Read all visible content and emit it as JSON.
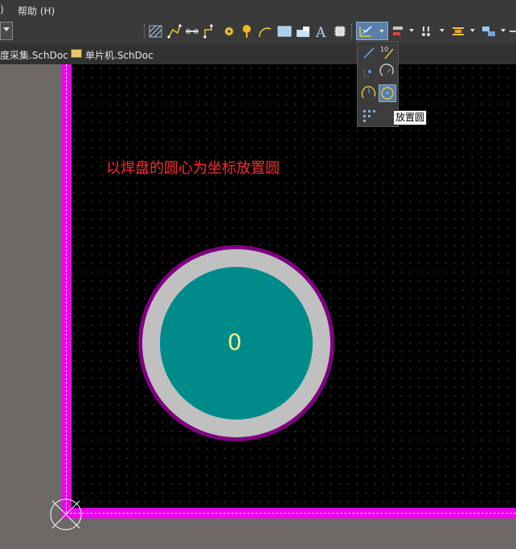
{
  "menubar": {
    "items": [
      {
        "label": ")"
      },
      {
        "label": "帮助 (H)"
      }
    ]
  },
  "toolbar": {
    "icons": [
      "hatch-icon",
      "wire-icon",
      "bus-icon",
      "net-icon",
      "junction-icon",
      "port-icon",
      "arc-icon",
      "sheet-symbol-icon",
      "sheet-entry-icon",
      "text-icon",
      "component-icon",
      "drawing-tools-icon",
      "align-icon",
      "harness-icon",
      "directive-icon",
      "sheet-icon"
    ]
  },
  "tabs": [
    {
      "label": "度采集.SchDoc"
    },
    {
      "label": "单片机.SchDoc"
    }
  ],
  "canvas": {
    "annotation": "以焊盘的圆心为坐标放置圆",
    "pad": {
      "designator": "0",
      "outer_color": "#800080",
      "ring_color": "#c0c0c0",
      "hole_color": "#008b8b"
    },
    "border_color": "#ff00ff"
  },
  "drawing_tools_menu": {
    "tools": [
      "line-icon",
      "dimension-icon",
      "point-icon",
      "arc-icon",
      "elliptical-arc-icon",
      "circle-icon",
      "array-icon"
    ],
    "selected": "circle-icon",
    "tooltip": "放置圆"
  }
}
